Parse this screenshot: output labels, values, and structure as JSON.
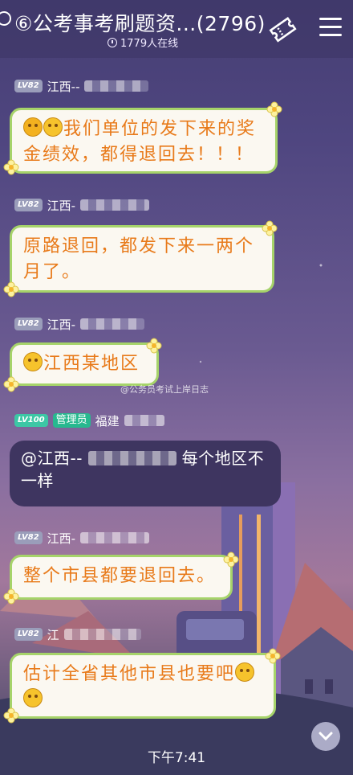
{
  "header": {
    "title": "⑥公考事考刷题资...(2796)",
    "online": "1779人在线",
    "menu_icon": "hamburger-icon",
    "ticket_icon": "ticket-icon"
  },
  "messages": [
    {
      "level": "LV82",
      "name": "江西--",
      "text": "我们单位的发下来的奖金绩效，都得退回去！！！"
    },
    {
      "level": "LV82",
      "name": "江西-",
      "text": "原路退回，都发下来一两个月了。"
    },
    {
      "level": "LV82",
      "name": "江西-",
      "text": "江西某地区"
    },
    {
      "level": "LV100",
      "role": "管理员",
      "name": "福建",
      "text": "@江西--",
      "text2": "每个地区不一样"
    },
    {
      "level": "LV82",
      "name": "江西-",
      "text": "整个市县都要退回去。"
    },
    {
      "level": "LV82",
      "name": "江",
      "text": "估计全省其他市县也要吧"
    }
  ],
  "watermark": "@公务员考试上岸日志",
  "footer_time": "下午7:41",
  "colors": {
    "bubble_text": "#e87a1a",
    "bubble_border": "#a6d36a",
    "admin_badge": "#27b98f"
  }
}
